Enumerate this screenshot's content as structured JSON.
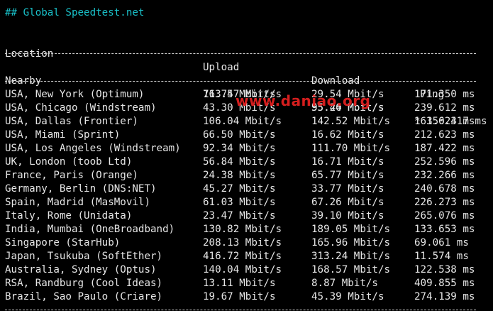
{
  "title": "## Global Speedtest.net",
  "headers": {
    "location": "Location",
    "upload": "Upload",
    "download": "Download",
    "ping": "Ping"
  },
  "nearby": {
    "location": "Nearby",
    "upload": "113.57 Mbit/s",
    "download": "95.40 Mbit/s",
    "ping": "* 150.317 ms"
  },
  "rows": [
    {
      "location": "USA, New York (Optimum)",
      "upload": "76.74 Mbit/s",
      "download": "29.54 Mbit/s",
      "ping": "171.350 ms"
    },
    {
      "location": "USA, Chicago (Windstream)",
      "upload": "43.30 Mbit/s",
      "download": "55.24 Mbit/s",
      "ping": "239.612 ms"
    },
    {
      "location": "USA, Dallas (Frontier)",
      "upload": "106.04 Mbit/s",
      "download": "142.52 Mbit/s",
      "ping": "163.624 ms"
    },
    {
      "location": "USA, Miami (Sprint)",
      "upload": "66.50 Mbit/s",
      "download": "16.62 Mbit/s",
      "ping": "212.623 ms"
    },
    {
      "location": "USA, Los Angeles (Windstream)",
      "upload": "92.34 Mbit/s",
      "download": "111.70 Mbit/s",
      "ping": "187.422 ms"
    },
    {
      "location": "UK, London (toob Ltd)",
      "upload": "56.84 Mbit/s",
      "download": "16.71 Mbit/s",
      "ping": "252.596 ms"
    },
    {
      "location": "France, Paris (Orange)",
      "upload": "24.38 Mbit/s",
      "download": "65.77 Mbit/s",
      "ping": "232.266 ms"
    },
    {
      "location": "Germany, Berlin (DNS:NET)",
      "upload": "45.27 Mbit/s",
      "download": "33.77 Mbit/s",
      "ping": "240.678 ms"
    },
    {
      "location": "Spain, Madrid (MasMovil)",
      "upload": "61.03 Mbit/s",
      "download": "67.26 Mbit/s",
      "ping": "226.273 ms"
    },
    {
      "location": "Italy, Rome (Unidata)",
      "upload": "23.47 Mbit/s",
      "download": "39.10 Mbit/s",
      "ping": "265.076 ms"
    },
    {
      "location": "India, Mumbai (OneBroadband)",
      "upload": "130.82 Mbit/s",
      "download": "189.05 Mbit/s",
      "ping": "133.653 ms"
    },
    {
      "location": "Singapore (StarHub)",
      "upload": "208.13 Mbit/s",
      "download": "165.96 Mbit/s",
      "ping": "69.061 ms"
    },
    {
      "location": "Japan, Tsukuba (SoftEther)",
      "upload": "416.72 Mbit/s",
      "download": "313.24 Mbit/s",
      "ping": "11.574 ms"
    },
    {
      "location": "Australia, Sydney (Optus)",
      "upload": "140.04 Mbit/s",
      "download": "168.57 Mbit/s",
      "ping": "122.538 ms"
    },
    {
      "location": "RSA, Randburg (Cool Ideas)",
      "upload": "13.11 Mbit/s",
      "download": "8.87 Mbit/s",
      "ping": "409.855 ms"
    },
    {
      "location": "Brazil, Sao Paulo (Criare)",
      "upload": "19.67 Mbit/s",
      "download": "45.39 Mbit/s",
      "ping": "274.139 ms"
    }
  ],
  "watermark": "www.daniao.org",
  "colors": {
    "background": "#000000",
    "text": "#e6e6e6",
    "title": "#19c0c8",
    "watermark": "#e02020"
  }
}
